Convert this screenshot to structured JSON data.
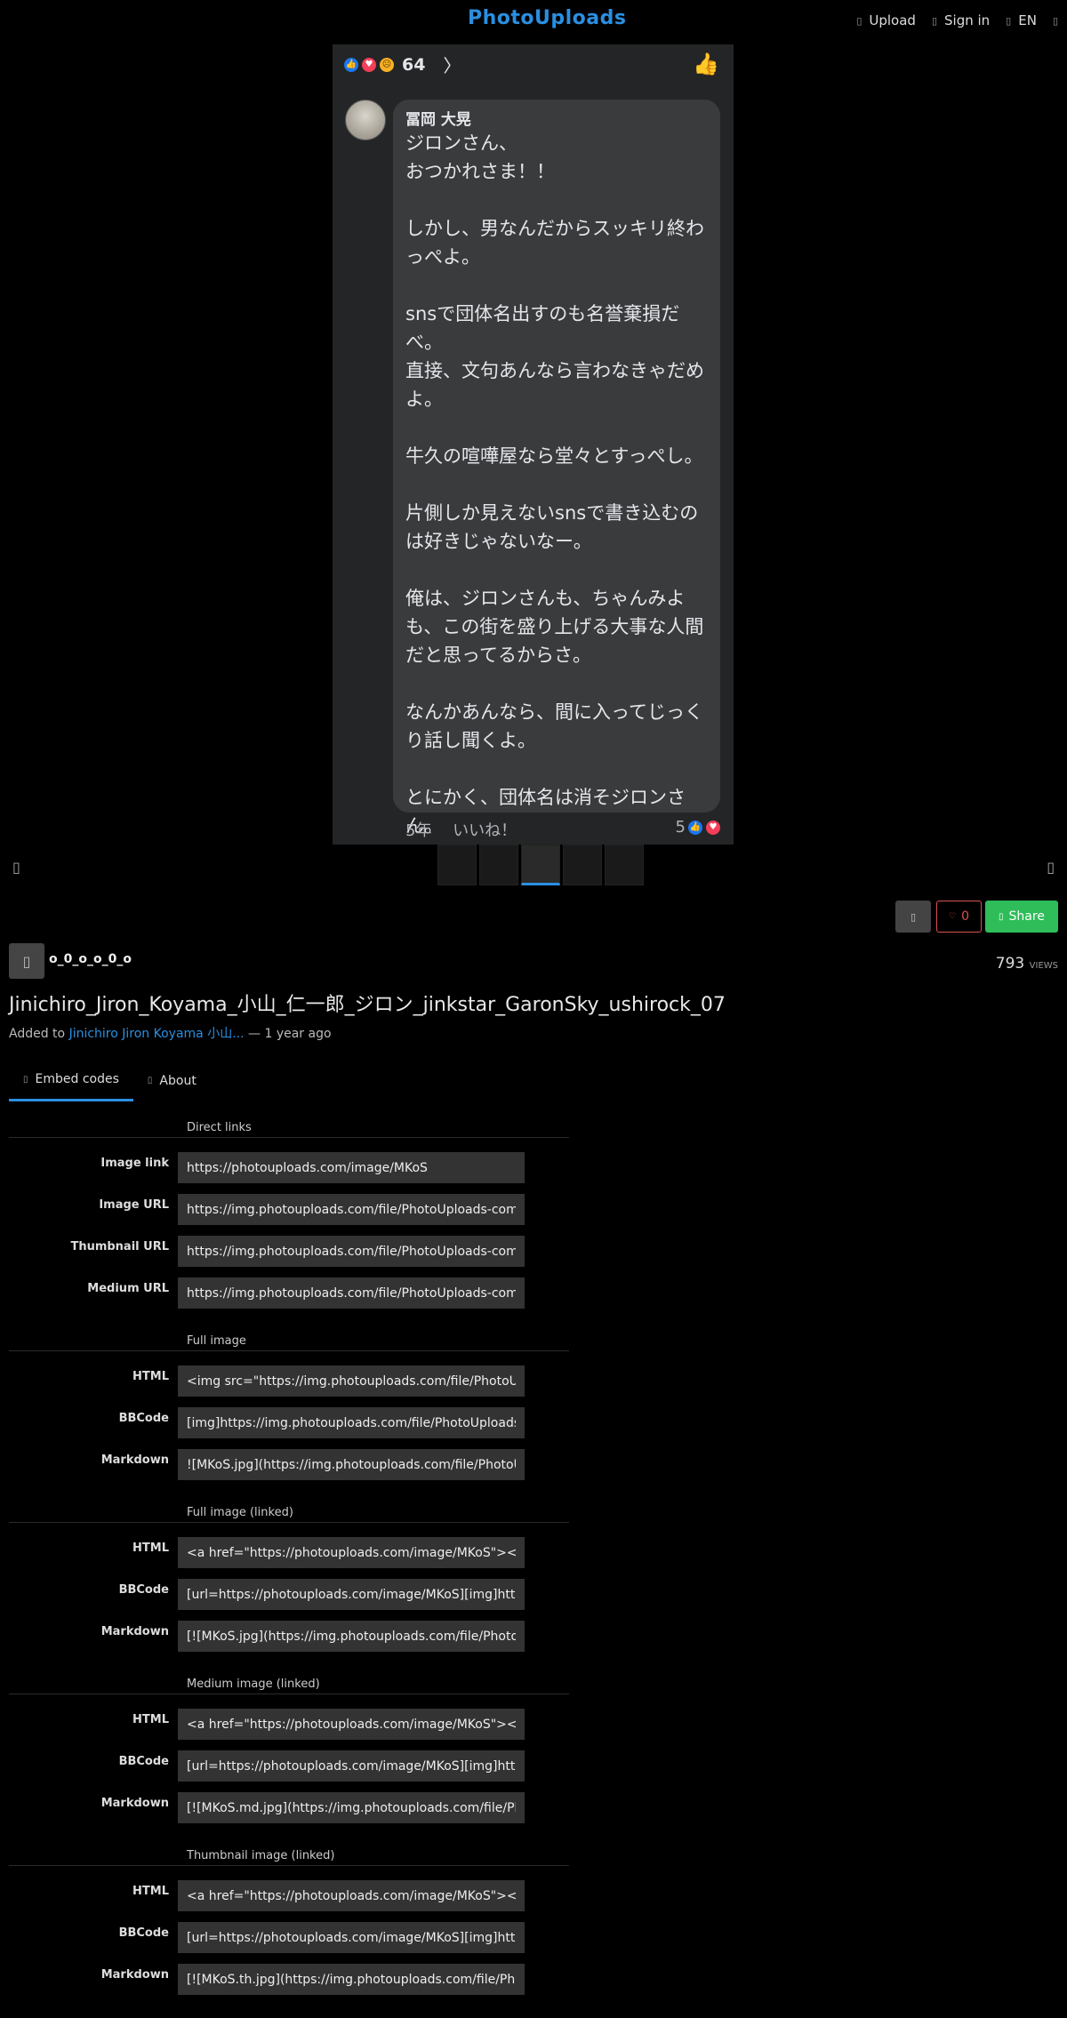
{
  "header": {
    "logo": "PhotoUploads",
    "nav": [
      {
        "icon": "upload-icon",
        "label": "Upload"
      },
      {
        "icon": "user-icon",
        "label": "Sign in"
      },
      {
        "icon": "globe-icon",
        "label": "EN"
      },
      {
        "icon": "search-icon",
        "label": ""
      }
    ]
  },
  "post": {
    "reaction_count": "64",
    "author": "冨岡 大晃",
    "comment": "ジロンさん、\nおつかれさま！！\n\nしかし、男なんだからスッキリ終わっぺよ。\n\nsnsで団体名出すのも名誉棄損だべ。\n直接、文句あんなら言わなきゃだめよ。\n\n牛久の喧嘩屋なら堂々とすっぺし。\n\n片側しか見えないsnsで書き込むのは好きじゃないなー。\n\n俺は、ジロンさんも、ちゃんみよも、この街を盛り上げる大事な人間だと思ってるからさ。\n\nなんかあんなら、間に入ってじっくり話し聞くよ。\n\nとにかく、団体名は消そジロンさん。",
    "meta": "5年　 いいね！",
    "meta_count": "5"
  },
  "actions": {
    "like_count": "0",
    "share_label": "Share"
  },
  "uploader": {
    "username": "o_0_o_o_0_o",
    "views": "793",
    "views_label": "VIEWS"
  },
  "image": {
    "title": "Jinichiro_Jiron_Koyama_小山_仁一郎_ジロン_jinkstar_GaronSky_ushirock_07",
    "added_prefix": "Added to",
    "album": "Jinichiro Jiron Koyama 小山...",
    "added_suffix": "— 1 year ago"
  },
  "tabs": [
    {
      "label": "Embed codes",
      "active": true
    },
    {
      "label": "About",
      "active": false
    }
  ],
  "embed_groups": [
    {
      "title": "Direct links",
      "rows": [
        {
          "label": "Image link",
          "value": "https://photouploads.com/image/MKoS"
        },
        {
          "label": "Image URL",
          "value": "https://img.photouploads.com/file/PhotoUploads-com/MKoS.jpg"
        },
        {
          "label": "Thumbnail URL",
          "value": "https://img.photouploads.com/file/PhotoUploads-com/MKoS.th.jpg"
        },
        {
          "label": "Medium URL",
          "value": "https://img.photouploads.com/file/PhotoUploads-com/MKoS.md.jpg"
        }
      ]
    },
    {
      "title": "Full image",
      "rows": [
        {
          "label": "HTML",
          "value": "<img src=\"https://img.photouploads.com/file/PhotoUploads-com/MKoS.jpg\">"
        },
        {
          "label": "BBCode",
          "value": "[img]https://img.photouploads.com/file/PhotoUploads-com/MKoS.jpg[/img]"
        },
        {
          "label": "Markdown",
          "value": "![MKoS.jpg](https://img.photouploads.com/file/PhotoUploads-com/MKoS.jpg)"
        }
      ]
    },
    {
      "title": "Full image (linked)",
      "rows": [
        {
          "label": "HTML",
          "value": "<a href=\"https://photouploads.com/image/MKoS\"><img src=\"https://img.photouploads.com/file/PhotoUploads-com/MKoS.jpg\"></a>"
        },
        {
          "label": "BBCode",
          "value": "[url=https://photouploads.com/image/MKoS][img]https://img.photouploads.com/file/PhotoUploads-com/MKoS.jpg[/img][/url]"
        },
        {
          "label": "Markdown",
          "value": "[![MKoS.jpg](https://img.photouploads.com/file/PhotoUploads-com/MKoS.jpg)](https://photouploads.com/image/MKoS)"
        }
      ]
    },
    {
      "title": "Medium image (linked)",
      "rows": [
        {
          "label": "HTML",
          "value": "<a href=\"https://photouploads.com/image/MKoS\"><img src=\"https://img.photouploads.com/file/PhotoUploads-com/MKoS.md.jpg\"></a>"
        },
        {
          "label": "BBCode",
          "value": "[url=https://photouploads.com/image/MKoS][img]https://img.photouploads.com/file/PhotoUploads-com/MKoS.md.jpg[/img][/url]"
        },
        {
          "label": "Markdown",
          "value": "[![MKoS.md.jpg](https://img.photouploads.com/file/PhotoUploads-com/MKoS.md.jpg)](https://photouploads.com/image/MKoS)"
        }
      ]
    },
    {
      "title": "Thumbnail image (linked)",
      "rows": [
        {
          "label": "HTML",
          "value": "<a href=\"https://photouploads.com/image/MKoS\"><img src=\"https://img.photouploads.com/file/PhotoUploads-com/MKoS.th.jpg\"></a>"
        },
        {
          "label": "BBCode",
          "value": "[url=https://photouploads.com/image/MKoS][img]https://img.photouploads.com/file/PhotoUploads-com/MKoS.th.jpg[/img][/url]"
        },
        {
          "label": "Markdown",
          "value": "[![MKoS.th.jpg](https://img.photouploads.com/file/PhotoUploads-com/MKoS.th.jpg)](https://photouploads.com/image/MKoS)"
        }
      ]
    }
  ]
}
